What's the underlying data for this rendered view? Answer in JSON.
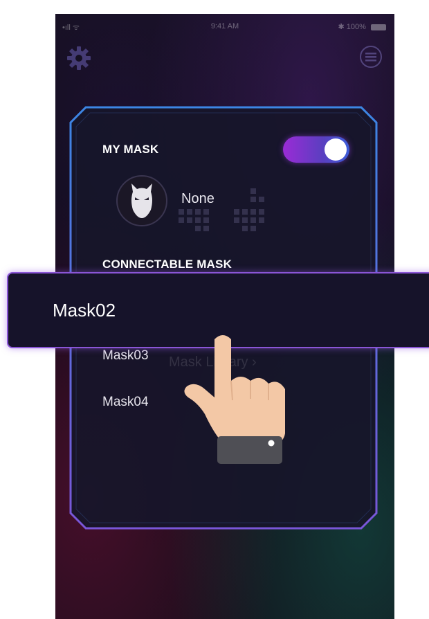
{
  "status_bar": {
    "signal": "•ıll ᯤ",
    "time": "9:41 AM",
    "battery": "✱ 100%"
  },
  "toggle": {
    "on": true
  },
  "my_mask": {
    "heading": "MY MASK",
    "selected_name": "None",
    "avatar_icon": "mask-icon"
  },
  "connectable": {
    "heading": "CONNECTABLE MASK",
    "items": [
      "Mask02",
      "Mask03",
      "Mask04"
    ]
  },
  "background_text": "Mask Library  ›",
  "icons": {
    "settings": "gear-icon",
    "menu": "menu-icon",
    "pointer": "hand-pointer-icon"
  },
  "colors": {
    "accent_purple": "#9a2bd6",
    "accent_blue": "#3d5cd8",
    "panel_border": "#3c86e4",
    "highlight_border": "#8a55d6"
  }
}
